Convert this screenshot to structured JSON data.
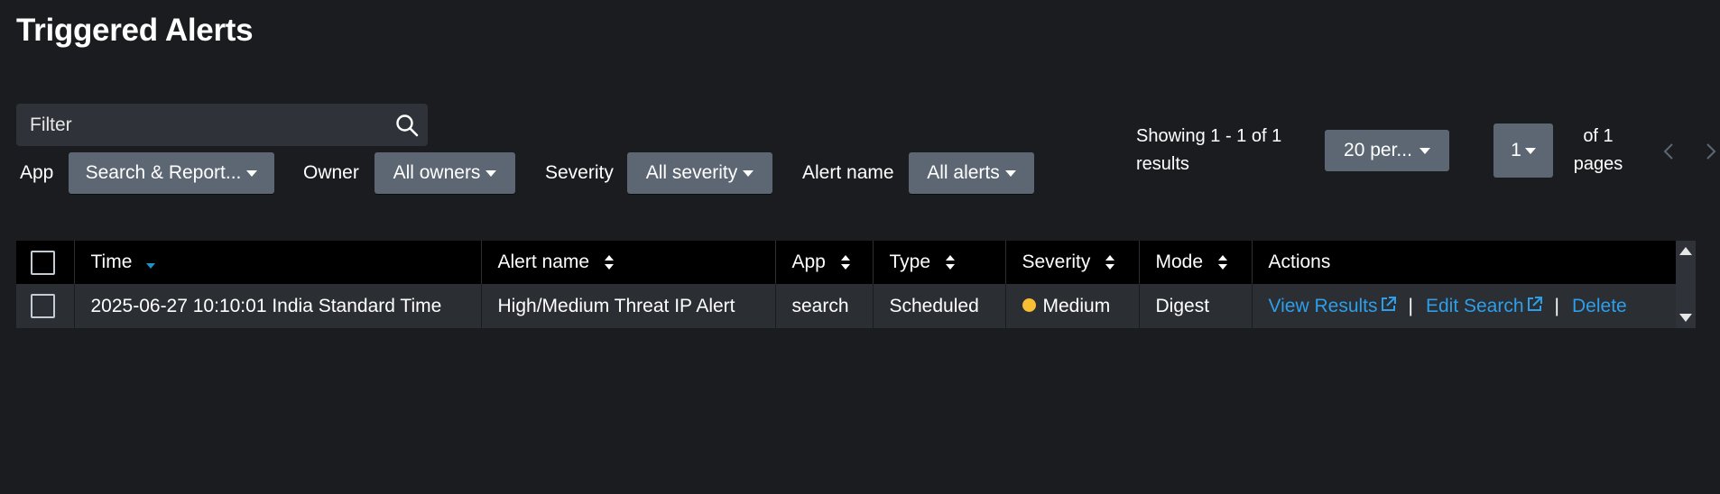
{
  "page": {
    "title": "Triggered Alerts"
  },
  "filter": {
    "placeholder": "Filter"
  },
  "filters": {
    "app": {
      "label": "App",
      "value": "Search & Report..."
    },
    "owner": {
      "label": "Owner",
      "value": "All owners"
    },
    "severity": {
      "label": "Severity",
      "value": "All severity"
    },
    "alert_name": {
      "label": "Alert name",
      "value": "All alerts"
    }
  },
  "paging": {
    "showing_line1": "Showing 1 - 1 of 1",
    "showing_line2": "results",
    "per_page": "20 per...",
    "current_page": "1",
    "of_line1": "of 1",
    "of_line2": "pages"
  },
  "table": {
    "headers": {
      "time": "Time",
      "alert_name": "Alert name",
      "app": "App",
      "type": "Type",
      "severity": "Severity",
      "mode": "Mode",
      "actions": "Actions"
    },
    "rows": [
      {
        "time": "2025-06-27 10:10:01 India Standard Time",
        "alert_name": "High/Medium Threat IP Alert",
        "app": "search",
        "type": "Scheduled",
        "severity": "Medium",
        "mode": "Digest",
        "action_view": "View Results",
        "action_edit": "Edit Search",
        "action_delete": "Delete",
        "separator": "|"
      }
    ]
  },
  "colors": {
    "background": "#1a1c20",
    "header_bg": "#000000",
    "row_bg": "#2b2e33",
    "dropdown_bg": "#5c6773",
    "link": "#2d9fea",
    "severity_medium": "#f8be34"
  }
}
